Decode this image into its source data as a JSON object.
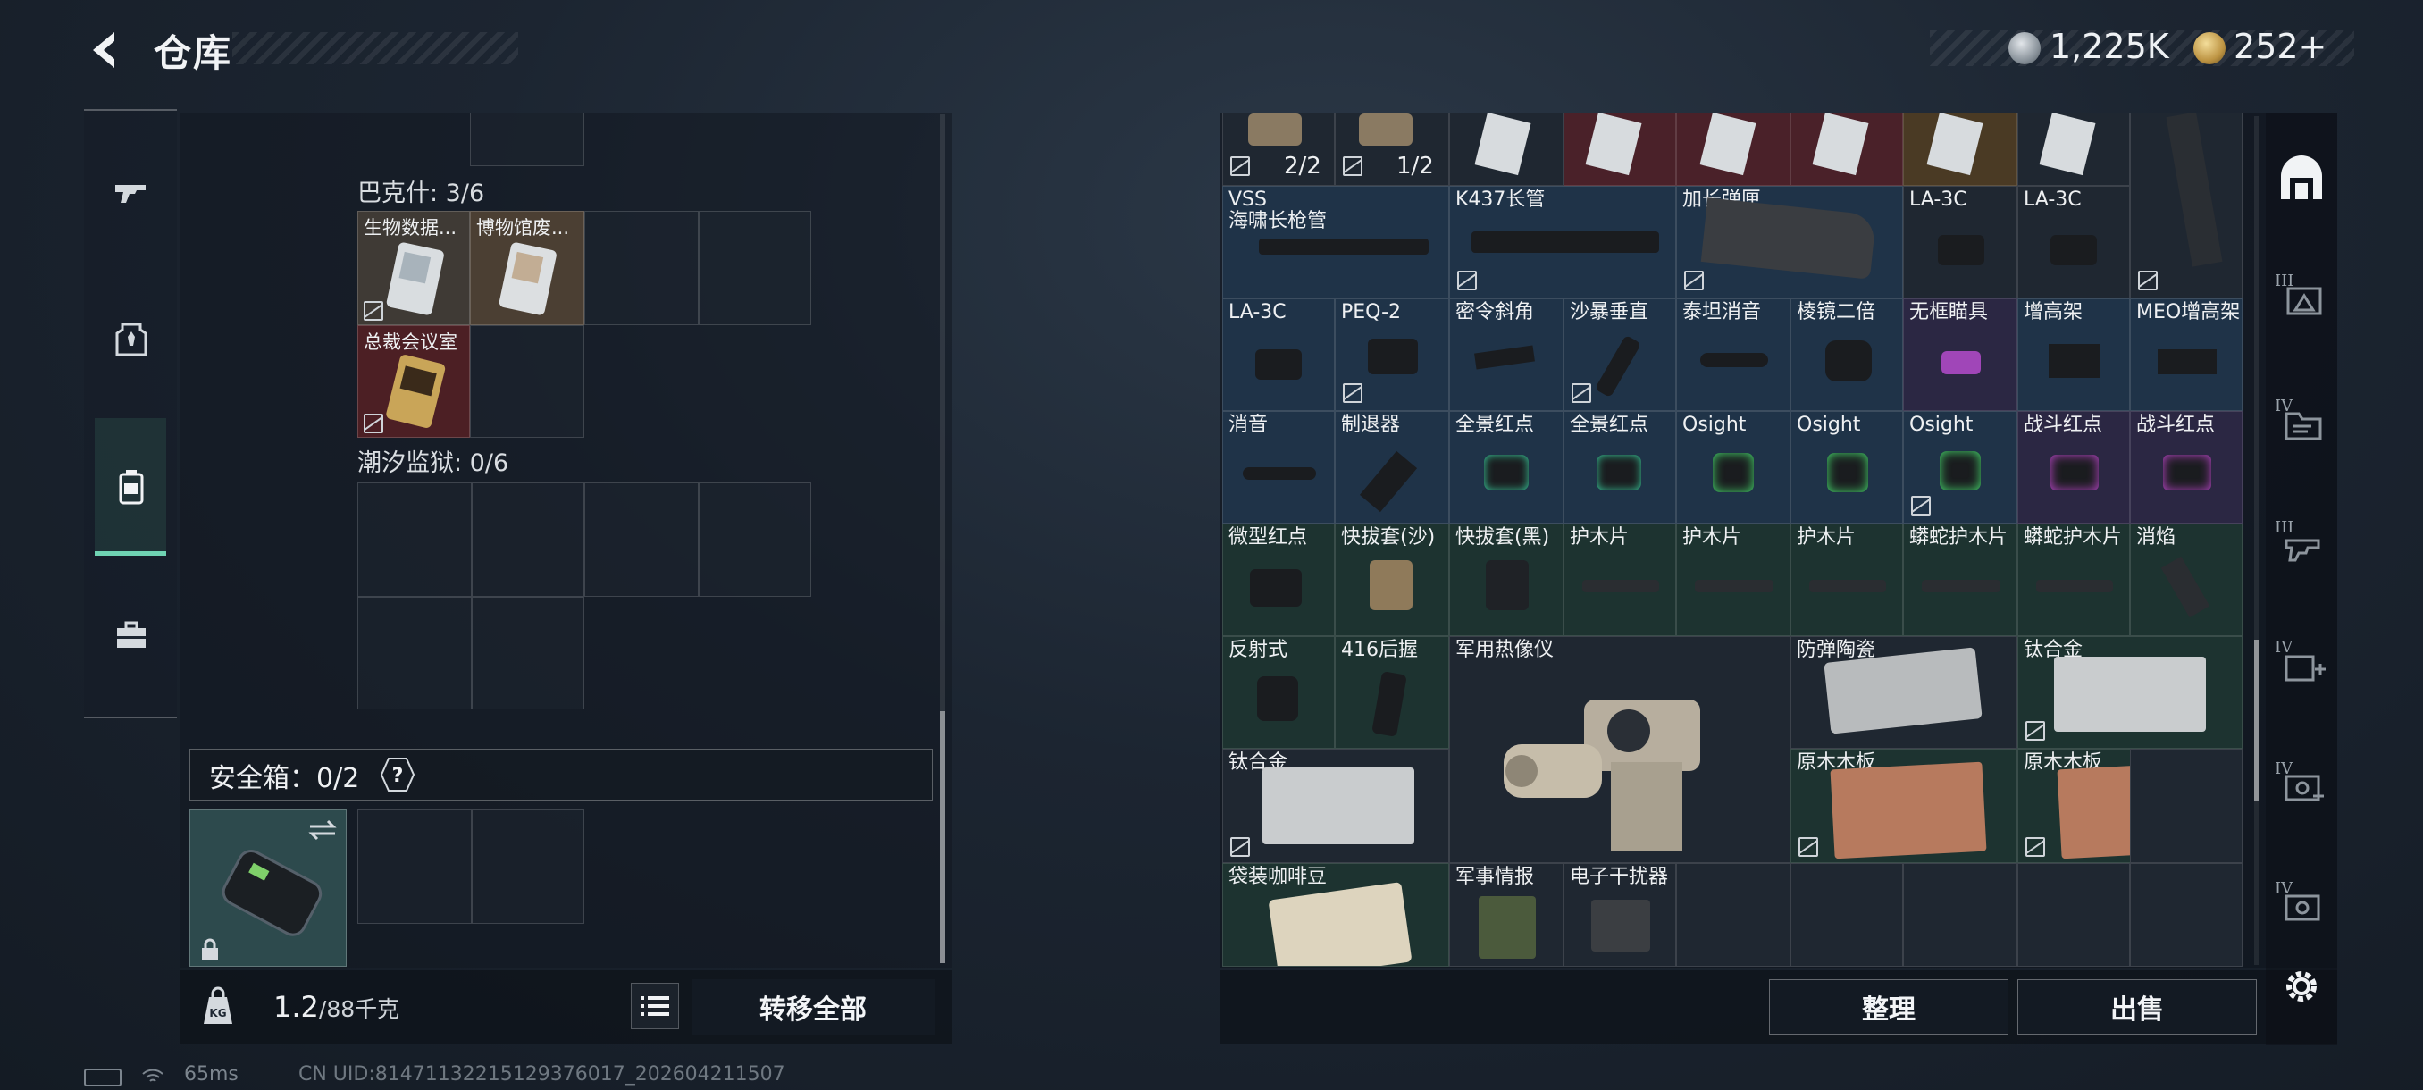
{
  "header": {
    "title": "仓库",
    "currency": [
      {
        "icon": "silver-coin-icon",
        "value": "1,225K"
      },
      {
        "icon": "gold-coin-icon",
        "value": "252+"
      }
    ]
  },
  "left_nav": {
    "items": [
      {
        "name": "weapons",
        "icon": "gun-icon"
      },
      {
        "name": "gear",
        "icon": "armor-icon"
      },
      {
        "name": "containers",
        "icon": "case-icon",
        "active": true
      },
      {
        "name": "supplies",
        "icon": "toolbox-icon"
      }
    ]
  },
  "storage": {
    "sections": [
      {
        "label": "巴克什: 3/6",
        "items": [
          "生物数据...",
          "博物馆废...",
          "总裁会议室"
        ]
      },
      {
        "label": "潮汐监狱: 0/6",
        "items": []
      }
    ],
    "safebox": {
      "label": "安全箱：0/2",
      "help": "?"
    },
    "weight": {
      "value": "1.2",
      "capacity": "/88千克"
    },
    "transfer_all": "转移全部"
  },
  "inventory": {
    "top_counts": [
      "2/2",
      "1/2"
    ],
    "rows": [
      [
        {
          "name": "VSS",
          "name2": "海啸长枪管"
        },
        {
          "name": "K437长管"
        },
        {
          "name": "加长弹匣"
        },
        {
          "name": "LA-3C"
        },
        {
          "name": "LA-3C"
        }
      ],
      [
        {
          "name": "LA-3C"
        },
        {
          "name": "PEQ-2"
        },
        {
          "name": "密令斜角"
        },
        {
          "name": "沙暴垂直"
        },
        {
          "name": "泰坦消音"
        },
        {
          "name": "棱镜二倍"
        },
        {
          "name": "无框瞄具"
        },
        {
          "name": "增高架"
        },
        {
          "name": "MEO增高架"
        }
      ],
      [
        {
          "name": "消音"
        },
        {
          "name": "制退器"
        },
        {
          "name": "全景红点"
        },
        {
          "name": "全景红点"
        },
        {
          "name": "Osight"
        },
        {
          "name": "Osight"
        },
        {
          "name": "Osight"
        },
        {
          "name": "战斗红点"
        },
        {
          "name": "战斗红点"
        }
      ],
      [
        {
          "name": "微型红点"
        },
        {
          "name": "快拔套(沙)"
        },
        {
          "name": "快拔套(黑)"
        },
        {
          "name": "护木片"
        },
        {
          "name": "护木片"
        },
        {
          "name": "护木片"
        },
        {
          "name": "蟒蛇护木片"
        },
        {
          "name": "蟒蛇护木片"
        },
        {
          "name": "消焰"
        }
      ],
      [
        {
          "name": "反射式"
        },
        {
          "name": "416后握"
        },
        {
          "name": "军用热像仪"
        },
        {
          "name": "防弹陶瓷"
        },
        {
          "name": "钛合金"
        }
      ],
      [
        {
          "name": "钛合金"
        },
        {
          "name": "原木木板"
        },
        {
          "name": "原木木板"
        }
      ],
      [
        {
          "name": "袋装咖啡豆"
        },
        {
          "name": "军事情报"
        },
        {
          "name": "电子干扰器"
        }
      ]
    ],
    "buttons": {
      "sort": "整理",
      "sell": "出售"
    }
  },
  "right_nav": {
    "levels": [
      "III",
      "IV",
      "III",
      "IV",
      "IV",
      "IV"
    ]
  },
  "status": {
    "ping": "65ms",
    "uid": "CN UID:8147113221512937601​7_202604211507"
  },
  "colors": {
    "accent": "#6fd3b2",
    "rarity_blue": "#1f3348",
    "rarity_green": "#1d3330",
    "rarity_red": "#4a2129",
    "rarity_purple": "#2b2743"
  }
}
